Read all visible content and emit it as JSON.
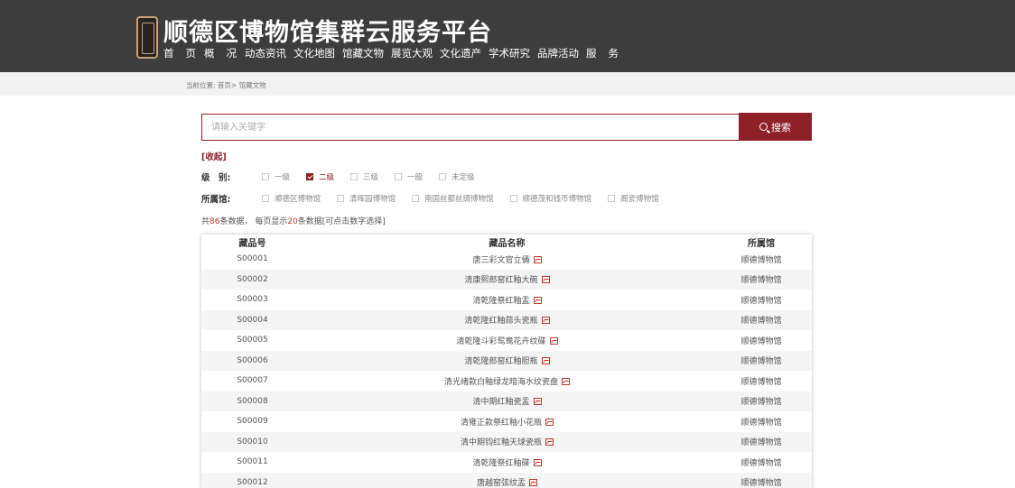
{
  "header": {
    "title": "顺德区博物馆集群云服务平台",
    "nav": [
      {
        "label": "首页",
        "name": "nav-home",
        "spaced": true
      },
      {
        "label": "概况",
        "name": "nav-overview",
        "spaced": true
      },
      {
        "label": "动态资讯",
        "name": "nav-news",
        "spaced": false
      },
      {
        "label": "文化地图",
        "name": "nav-culture-map",
        "spaced": false
      },
      {
        "label": "馆藏文物",
        "name": "nav-collection",
        "spaced": false
      },
      {
        "label": "展览大观",
        "name": "nav-exhibitions",
        "spaced": false
      },
      {
        "label": "文化遗产",
        "name": "nav-heritage",
        "spaced": false
      },
      {
        "label": "学术研究",
        "name": "nav-research",
        "spaced": false
      },
      {
        "label": "品牌活动",
        "name": "nav-brand-events",
        "spaced": false
      },
      {
        "label": "服务",
        "name": "nav-services",
        "spaced": true
      }
    ]
  },
  "breadcrumb": "当前位置: 首页> 馆藏文物",
  "search": {
    "placeholder": "请输入关键字",
    "button_label": "搜索"
  },
  "collapse_label": "[收起]",
  "filters": {
    "level": {
      "label": "级　别:",
      "options": [
        {
          "label": "一级",
          "checked": false
        },
        {
          "label": "二级",
          "checked": true
        },
        {
          "label": "三级",
          "checked": false
        },
        {
          "label": "一般",
          "checked": false
        },
        {
          "label": "未定级",
          "checked": false
        }
      ]
    },
    "museum": {
      "label": "所属馆:",
      "options": [
        {
          "label": "顺德区博物馆",
          "checked": false
        },
        {
          "label": "清晖园博物馆",
          "checked": false
        },
        {
          "label": "南国丝都丝绸博物馆",
          "checked": false
        },
        {
          "label": "顺德茂和钱币博物馆",
          "checked": false
        },
        {
          "label": "阁瓷博物馆",
          "checked": false
        }
      ]
    }
  },
  "summary": {
    "prefix": "共",
    "total": "86",
    "mid": "条数据，  每页显示",
    "per_page": "20",
    "suffix": "条数据[可点击数字选择]"
  },
  "table": {
    "headers": [
      "藏品号",
      "藏品名称",
      "所属馆"
    ],
    "rows": [
      [
        "S00001",
        "唐三彩文官立俑",
        "顺德博物馆"
      ],
      [
        "S00002",
        "清康熙郎窑红釉大碗",
        "顺德博物馆"
      ],
      [
        "S00003",
        "清乾隆祭红釉盂",
        "顺德博物馆"
      ],
      [
        "S00004",
        "清乾隆红釉蒜头瓷瓶",
        "顺德博物馆"
      ],
      [
        "S00005",
        "清乾隆斗彩鸳鸯花卉纹碟",
        "顺德博物馆"
      ],
      [
        "S00006",
        "清乾隆郎窑红釉胆瓶",
        "顺德博物馆"
      ],
      [
        "S00007",
        "清光绪款白釉绿龙暗海水纹瓷盘",
        "顺德博物馆"
      ],
      [
        "S00008",
        "清中期红釉瓷盂",
        "顺德博物馆"
      ],
      [
        "S00009",
        "清雍正款祭红釉小花瓶",
        "顺德博物馆"
      ],
      [
        "S00010",
        "清中期钧红釉天球瓷瓶",
        "顺德博物馆"
      ],
      [
        "S00011",
        "清乾隆祭红釉碟",
        "顺德博物馆"
      ],
      [
        "S00012",
        "唐越窑弦纹盂",
        "顺德博物馆"
      ]
    ]
  },
  "colors": {
    "accent": "#8e2127",
    "header_bg": "#3d3d3d",
    "highlight": "#c0392b"
  },
  "icons": {
    "search": "search-icon",
    "image": "image-icon",
    "logo": "museum-logo"
  }
}
